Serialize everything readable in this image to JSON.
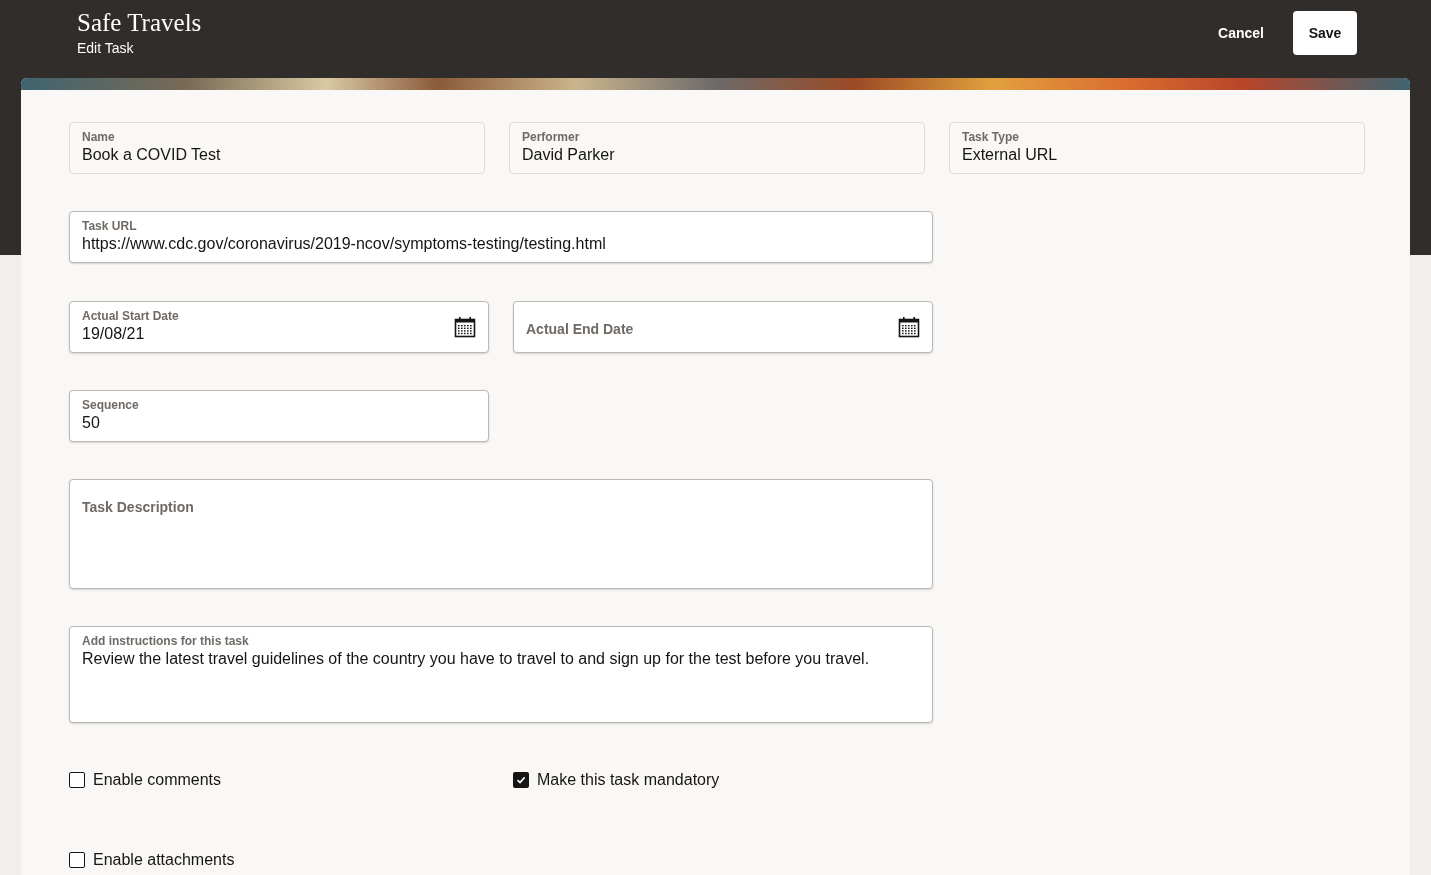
{
  "header": {
    "title": "Safe Travels",
    "subtitle": "Edit Task",
    "cancel": "Cancel",
    "save": "Save"
  },
  "summary_fields": [
    {
      "label": "Name",
      "value": "Book a COVID Test"
    },
    {
      "label": "Performer",
      "value": "David Parker"
    },
    {
      "label": "Task Type",
      "value": "External URL"
    }
  ],
  "task_url": {
    "label": "Task URL",
    "value": "https://www.cdc.gov/coronavirus/2019-ncov/symptoms-testing/testing.html"
  },
  "dates": [
    {
      "label": "Actual Start Date",
      "value": "19/08/21"
    },
    {
      "placeholder": "Actual End Date"
    }
  ],
  "sequence": {
    "label": "Sequence",
    "value": "50"
  },
  "description": {
    "placeholder": "Task Description"
  },
  "instructions": {
    "label": "Add instructions for this task",
    "value": "Review the latest travel guidelines of the country you have to travel to and sign up for the test before you travel."
  },
  "options": [
    [
      {
        "label": "Enable comments",
        "checked": false
      },
      {
        "label": "Make this task mandatory",
        "checked": true
      }
    ],
    [
      {
        "label": "Enable attachments",
        "checked": false
      }
    ]
  ]
}
